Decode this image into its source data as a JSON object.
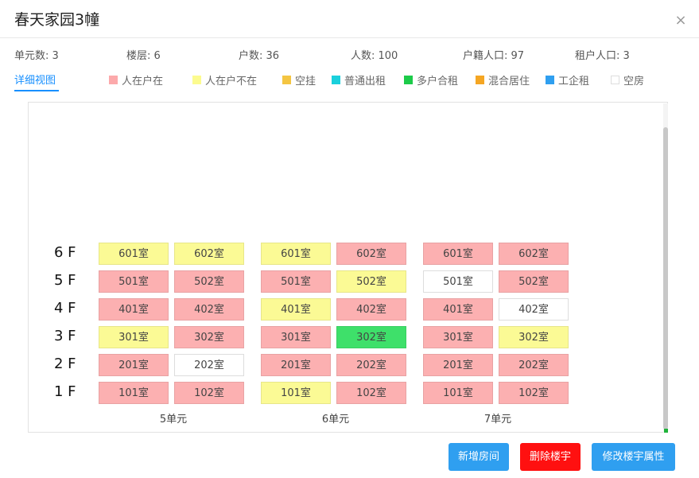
{
  "header": {
    "title": "春天家园3幢"
  },
  "stats": [
    {
      "label": "单元数: 3"
    },
    {
      "label": "楼层: 6"
    },
    {
      "label": "户数: 36"
    },
    {
      "label": "人数: 100"
    },
    {
      "label": "户籍人口: 97"
    },
    {
      "label": "租户人口: 3"
    }
  ],
  "view_tab": {
    "label": "详细视图"
  },
  "legend": [
    {
      "label": "人在户在",
      "color": "#fca9ab"
    },
    {
      "label": "人在户不在",
      "color": "#fcfb8f"
    },
    {
      "label": "空挂",
      "color": "#f4c542"
    },
    {
      "label": "普通出租",
      "color": "#1ad0dc"
    },
    {
      "label": "多户合租",
      "color": "#1ccb49"
    },
    {
      "label": "混合居住",
      "color": "#f5a623"
    },
    {
      "label": "工企租",
      "color": "#2f9ff0"
    },
    {
      "label": "空房",
      "color": "#ffffff"
    }
  ],
  "floors": [
    "6 F",
    "5 F",
    "4 F",
    "3 F",
    "2 F",
    "1 F"
  ],
  "units": [
    {
      "label": "5单元",
      "rows": [
        [
          {
            "name": "601室",
            "status": "yellow"
          },
          {
            "name": "602室",
            "status": "yellow"
          }
        ],
        [
          {
            "name": "501室",
            "status": "pink"
          },
          {
            "name": "502室",
            "status": "pink"
          }
        ],
        [
          {
            "name": "401室",
            "status": "pink"
          },
          {
            "name": "402室",
            "status": "pink"
          }
        ],
        [
          {
            "name": "301室",
            "status": "yellow"
          },
          {
            "name": "302室",
            "status": "pink"
          }
        ],
        [
          {
            "name": "201室",
            "status": "pink"
          },
          {
            "name": "202室",
            "status": "white"
          }
        ],
        [
          {
            "name": "101室",
            "status": "pink"
          },
          {
            "name": "102室",
            "status": "pink"
          }
        ]
      ]
    },
    {
      "label": "6单元",
      "rows": [
        [
          {
            "name": "601室",
            "status": "yellow"
          },
          {
            "name": "602室",
            "status": "pink"
          }
        ],
        [
          {
            "name": "501室",
            "status": "pink"
          },
          {
            "name": "502室",
            "status": "yellow"
          }
        ],
        [
          {
            "name": "401室",
            "status": "yellow"
          },
          {
            "name": "402室",
            "status": "pink"
          }
        ],
        [
          {
            "name": "301室",
            "status": "pink"
          },
          {
            "name": "302室",
            "status": "green"
          }
        ],
        [
          {
            "name": "201室",
            "status": "pink"
          },
          {
            "name": "202室",
            "status": "pink"
          }
        ],
        [
          {
            "name": "101室",
            "status": "yellow"
          },
          {
            "name": "102室",
            "status": "pink"
          }
        ]
      ]
    },
    {
      "label": "7单元",
      "rows": [
        [
          {
            "name": "601室",
            "status": "pink"
          },
          {
            "name": "602室",
            "status": "pink"
          }
        ],
        [
          {
            "name": "501室",
            "status": "white"
          },
          {
            "name": "502室",
            "status": "pink"
          }
        ],
        [
          {
            "name": "401室",
            "status": "pink"
          },
          {
            "name": "402室",
            "status": "white"
          }
        ],
        [
          {
            "name": "301室",
            "status": "pink"
          },
          {
            "name": "302室",
            "status": "yellow"
          }
        ],
        [
          {
            "name": "201室",
            "status": "pink"
          },
          {
            "name": "202室",
            "status": "pink"
          }
        ],
        [
          {
            "name": "101室",
            "status": "pink"
          },
          {
            "name": "102室",
            "status": "pink"
          }
        ]
      ]
    }
  ],
  "status_colors": {
    "pink": "#fcb0b1",
    "yellow": "#fbfa95",
    "white": "#ffffff",
    "green": "#3ee06a"
  },
  "buttons": {
    "add_room": {
      "label": "新增房间",
      "color": "#2f9ff0"
    },
    "delete_building": {
      "label": "删除楼宇",
      "color": "#ff1010"
    },
    "edit_building": {
      "label": "修改楼宇属性",
      "color": "#2f9ff0"
    }
  }
}
